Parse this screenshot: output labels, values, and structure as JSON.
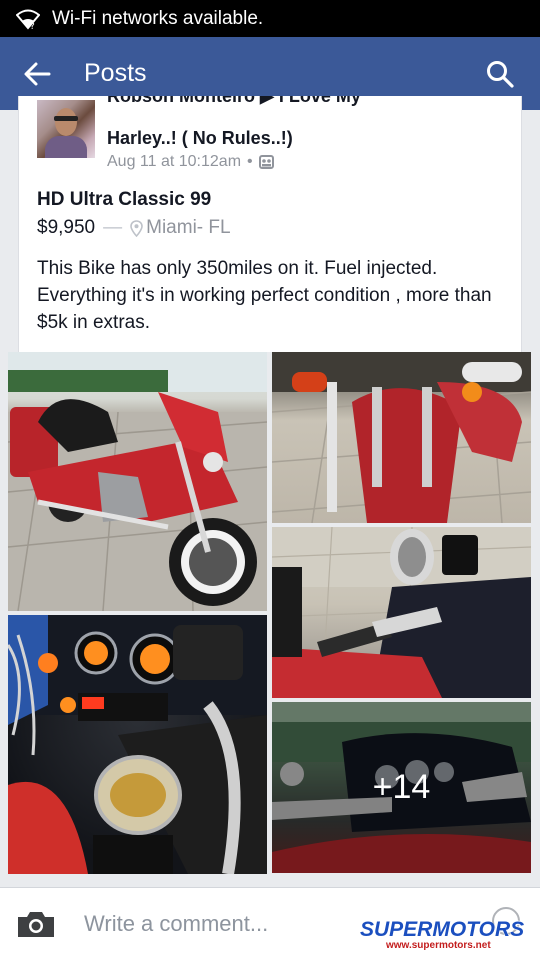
{
  "status_bar": {
    "notification": "Wi-Fi networks available."
  },
  "app_bar": {
    "title": "Posts"
  },
  "post": {
    "author_line1": "Robson Monteiro",
    "author_arrow": "▶",
    "group_line1": "I Love My",
    "group_line2": "Harley..! ( No Rules..!)",
    "timestamp": "Aug 11 at 10:12am",
    "meta_separator": "•",
    "item_title": "HD Ultra Classic 99",
    "price": "$9,950",
    "price_separator": "—",
    "location": "Miami- FL",
    "description": "This Bike has only 350miles on it. Fuel injected. Everything it's in working perfect condition , more than $5k in extras.",
    "more_photos": "+14"
  },
  "comment_bar": {
    "placeholder": "Write a comment..."
  },
  "watermark": {
    "brand": "SUPERMOTORS",
    "url": "www.supermotors.net"
  },
  "icons": [
    "wifi-icon",
    "back-arrow-icon",
    "search-icon",
    "group-icon",
    "location-pin-icon",
    "camera-icon"
  ],
  "colors": {
    "app_bar": "#3b5998",
    "status_bar": "#000000",
    "text": "#141823",
    "meta": "#90949c"
  }
}
